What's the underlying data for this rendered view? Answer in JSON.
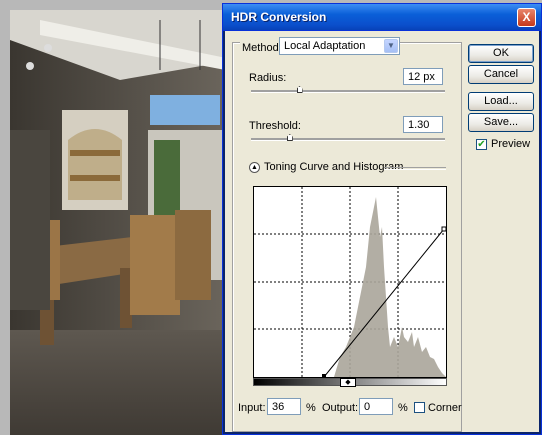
{
  "dialog": {
    "title": "HDR Conversion",
    "close_label": "X",
    "method_label": "Method:",
    "method_value": "Local Adaptation",
    "radius_label": "Radius:",
    "radius_value": "12 px",
    "radius_level": 0.25,
    "threshold_label": "Threshold:",
    "threshold_value": "1.30",
    "threshold_level": 0.2,
    "curve_section_label": "Toning Curve and Histogram",
    "input_label": "Input:",
    "input_value": "36",
    "input_unit": "%",
    "output_label": "Output:",
    "output_value": "0",
    "output_unit": "%",
    "corner_label": "Corner",
    "corner_checked": false,
    "preview_label": "Preview",
    "preview_checked": true
  },
  "buttons": {
    "ok": "OK",
    "cancel": "Cancel",
    "load": "Load...",
    "save": "Save..."
  }
}
